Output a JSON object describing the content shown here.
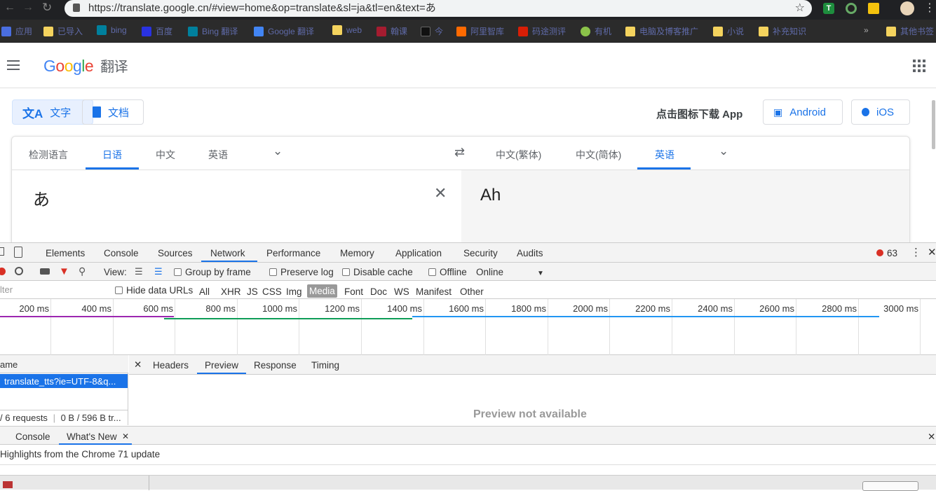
{
  "browser": {
    "url": "https://translate.google.cn/#view=home&op=translate&sl=ja&tl=en&text=あ",
    "bookmarks": [
      "应用",
      "已导入",
      "bing",
      "百度",
      "Bing 翻译",
      "Google 翻译",
      "web",
      "翰课",
      "今",
      "阿里智库",
      "码途测评",
      "有机",
      "电脑及博客推广",
      "小说",
      "补充知识",
      "其他书签"
    ],
    "bookmarks_more": "»"
  },
  "gt": {
    "logo_g": "Google",
    "logo_cn": "翻译",
    "mode_text": "文字",
    "mode_doc": "文档",
    "download_app": "点击图标下载 App",
    "android": "Android",
    "ios": "iOS",
    "src_langs": [
      "检测语言",
      "日语",
      "中文",
      "英语"
    ],
    "tgt_langs": [
      "中文(繁体)",
      "中文(简体)",
      "英语"
    ],
    "source_text": "あ",
    "translation": "Ah"
  },
  "devtools": {
    "tabs": [
      "Elements",
      "Console",
      "Sources",
      "Network",
      "Performance",
      "Memory",
      "Application",
      "Security",
      "Audits"
    ],
    "error_count": "63",
    "view_label": "View:",
    "group_by_frame": "Group by frame",
    "preserve_log": "Preserve log",
    "disable_cache": "Disable cache",
    "offline": "Offline",
    "throttle": "Online",
    "filter_placeholder": "lter",
    "hide_data_urls": "Hide data URLs",
    "filter_types": [
      "All",
      "XHR",
      "JS",
      "CSS",
      "Img",
      "Media",
      "Font",
      "Doc",
      "WS",
      "Manifest",
      "Other"
    ],
    "ticks": [
      "200 ms",
      "400 ms",
      "600 ms",
      "800 ms",
      "1000 ms",
      "1200 ms",
      "1400 ms",
      "1600 ms",
      "1800 ms",
      "2000 ms",
      "2200 ms",
      "2400 ms",
      "2600 ms",
      "2800 ms",
      "3000 ms"
    ],
    "name_header": "ame",
    "request_name": "translate_tts?ie=UTF-8&q...",
    "summary": "/ 6 requests",
    "transferred": "0 B / 596 B tr...",
    "detail_tabs": [
      "Headers",
      "Preview",
      "Response",
      "Timing"
    ],
    "preview_msg": "Preview not available",
    "drawer_tabs": [
      "Console",
      "What's New"
    ],
    "whats_new": "Highlights from the Chrome 71 update"
  }
}
